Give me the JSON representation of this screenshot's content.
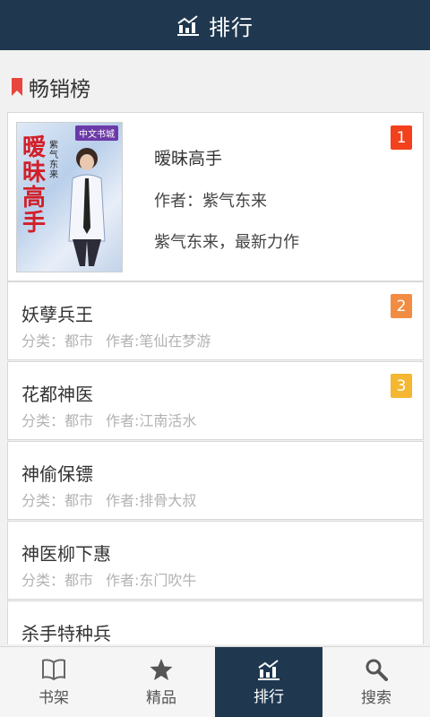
{
  "header": {
    "title": "排行",
    "icon": "chart-icon"
  },
  "section": {
    "title": "畅销榜",
    "icon": "bookmark-icon",
    "accent": "#e8453c"
  },
  "featured": {
    "rank": "1",
    "title": "暧昧高手",
    "author_line": "作者：紫气东来",
    "description": "紫气东来，最新力作",
    "cover": {
      "brand": "中文书城",
      "title": "暧昧高手",
      "subtitle": "紫气东来"
    }
  },
  "books": [
    {
      "rank": "2",
      "title": "妖孽兵王",
      "category": "分类：都市",
      "author": "作者:笔仙在梦游"
    },
    {
      "rank": "3",
      "title": "花都神医",
      "category": "分类：都市",
      "author": "作者:江南活水"
    },
    {
      "rank": "",
      "title": "神偷保镖",
      "category": "分类：都市",
      "author": "作者:排骨大叔"
    },
    {
      "rank": "",
      "title": "神医柳下惠",
      "category": "分类：都市",
      "author": "作者:东门吹牛"
    },
    {
      "rank": "",
      "title": "杀手特种兵",
      "category": "",
      "author": ""
    }
  ],
  "rank_colors": {
    "1": "#f2411c",
    "2": "#f28c43",
    "3": "#f5b731"
  },
  "tabs": [
    {
      "label": "书架",
      "icon": "open-book-icon",
      "active": false
    },
    {
      "label": "精品",
      "icon": "star-icon",
      "active": false
    },
    {
      "label": "排行",
      "icon": "chart-icon",
      "active": true
    },
    {
      "label": "搜索",
      "icon": "search-icon",
      "active": false
    }
  ],
  "colors": {
    "header_bg": "#1f3850",
    "active_tab_bg": "#1f3850"
  }
}
